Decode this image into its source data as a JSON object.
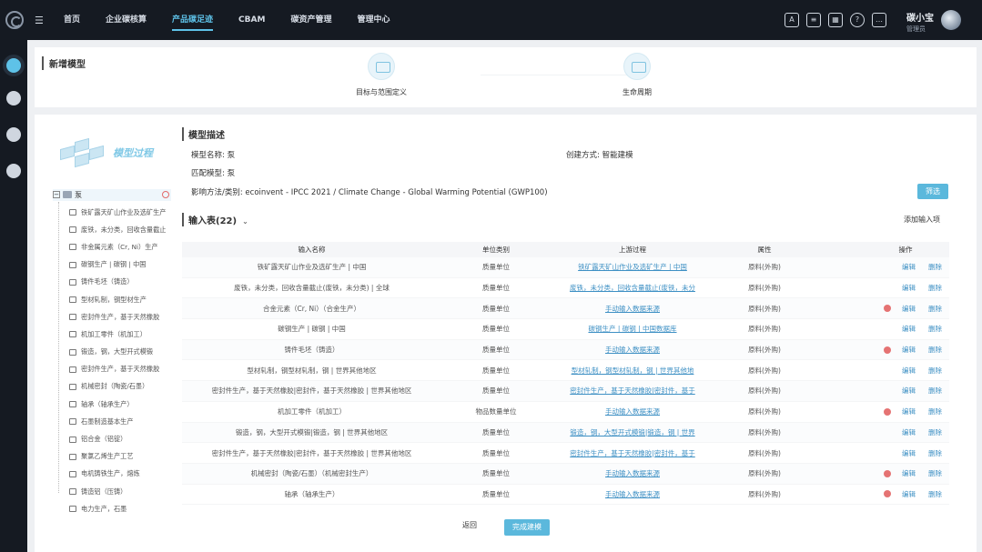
{
  "topbar": {
    "nav": [
      {
        "label": "首页",
        "active": false
      },
      {
        "label": "企业碳核算",
        "active": false
      },
      {
        "label": "产品碳足迹",
        "active": true
      },
      {
        "label": "CBAM",
        "active": false
      },
      {
        "label": "碳资产管理",
        "active": false
      },
      {
        "label": "管理中心",
        "active": false
      }
    ],
    "tool_icons": [
      "translate-icon",
      "ai-icon",
      "qrcode-icon",
      "help-icon",
      "message-icon"
    ],
    "user": {
      "name": "碳小宝",
      "role": "管理员"
    }
  },
  "sidebar": {
    "icons": [
      "footprint-icon",
      "leaf-icon",
      "pie-chart-icon",
      "database-icon"
    ]
  },
  "page": {
    "title": "新增模型",
    "steps": [
      {
        "label": "目标与范围定义"
      },
      {
        "label": "生命周期"
      }
    ]
  },
  "tree": {
    "banner_title": "模型过程",
    "root_label": "泵",
    "items": [
      "铁矿露天矿山作业及选矿生产",
      "废铁，未分类，回收含量截止",
      "非金属元素（Cr, Ni）生产",
      "碳钢生产 | 碳钢 | 中国",
      "铸件毛坯（铸造）",
      "型材轧制，钢型材生产",
      "密封件生产，基于天然橡胶",
      "机加工零件（机加工）",
      "锻造，钢，大型开式模锻",
      "密封件生产，基于天然橡胶",
      "机械密封（陶瓷/石墨）",
      "轴承（轴承生产）",
      "石墨制造基本生产",
      "铝合金（铝锭）",
      "聚氯乙烯生产工艺",
      "电机铸铁生产，熔炼",
      "铸造铝（压铸）",
      "电力生产，石墨"
    ]
  },
  "description": {
    "title": "模型描述",
    "model_name": "模型名称: 泵",
    "create_method": "创建方式: 智能建模",
    "match_model": "匹配模型: 泵",
    "impact_method": "影响方法/类别: ecoinvent - IPCC 2021 / Climate Change - Global Warming Potential (GWP100)",
    "filter_btn": "筛选"
  },
  "inputs": {
    "title": "输入表(22)",
    "add_btn": "添加输入项",
    "columns": [
      "输入名称",
      "单位类别",
      "上游过程",
      "属性",
      "操作"
    ],
    "rows": [
      {
        "name": "铁矿露天矿山作业及选矿生产 | 中国",
        "unit": "质量单位",
        "upstream": "铁矿露天矿山作业及选矿生产 | 中国",
        "attr": "原料(外购)",
        "warn": false
      },
      {
        "name": "废铁，未分类，回收含量截止(废铁，未分类) | 全球",
        "unit": "质量单位",
        "upstream": "废铁，未分类，回收含量截止(废铁，未分",
        "attr": "原料(外购)",
        "warn": false
      },
      {
        "name": "合金元素（Cr, Ni）（合金生产）",
        "unit": "质量单位",
        "upstream": "手动输入数据来源",
        "attr": "原料(外购)",
        "warn": true
      },
      {
        "name": "碳钢生产 | 碳钢 | 中国",
        "unit": "质量单位",
        "upstream": "碳钢生产 | 碳钢 | 中国数据库",
        "attr": "原料(外购)",
        "warn": false
      },
      {
        "name": "铸件毛坯（铸造）",
        "unit": "质量单位",
        "upstream": "手动输入数据来源",
        "attr": "原料(外购)",
        "warn": true
      },
      {
        "name": "型材轧制，钢型材轧制，钢 | 世界其他地区",
        "unit": "质量单位",
        "upstream": "型材轧制，钢型材轧制，钢 | 世界其他地",
        "attr": "原料(外购)",
        "warn": false
      },
      {
        "name": "密封件生产，基于天然橡胶|密封件，基于天然橡胶 | 世界其他地区",
        "unit": "质量单位",
        "upstream": "密封件生产，基于天然橡胶|密封件，基于",
        "attr": "原料(外购)",
        "warn": false
      },
      {
        "name": "机加工零件（机加工）",
        "unit": "物品数量单位",
        "upstream": "手动输入数据来源",
        "attr": "原料(外购)",
        "warn": true
      },
      {
        "name": "锻造，钢，大型开式模锻|锻造，钢 | 世界其他地区",
        "unit": "质量单位",
        "upstream": "锻造，钢，大型开式模锻|锻造，钢 | 世界",
        "attr": "原料(外购)",
        "warn": false
      },
      {
        "name": "密封件生产，基于天然橡胶|密封件，基于天然橡胶 | 世界其他地区",
        "unit": "质量单位",
        "upstream": "密封件生产，基于天然橡胶|密封件，基于",
        "attr": "原料(外购)",
        "warn": false
      },
      {
        "name": "机械密封（陶瓷/石墨）（机械密封生产）",
        "unit": "质量单位",
        "upstream": "手动输入数据来源",
        "attr": "原料(外购)",
        "warn": true
      },
      {
        "name": "轴承（轴承生产）",
        "unit": "质量单位",
        "upstream": "手动输入数据来源",
        "attr": "原料(外购)",
        "warn": true
      }
    ],
    "edit_label": "编辑",
    "delete_label": "删除"
  },
  "footer": {
    "back": "返回",
    "done": "完成建模"
  }
}
